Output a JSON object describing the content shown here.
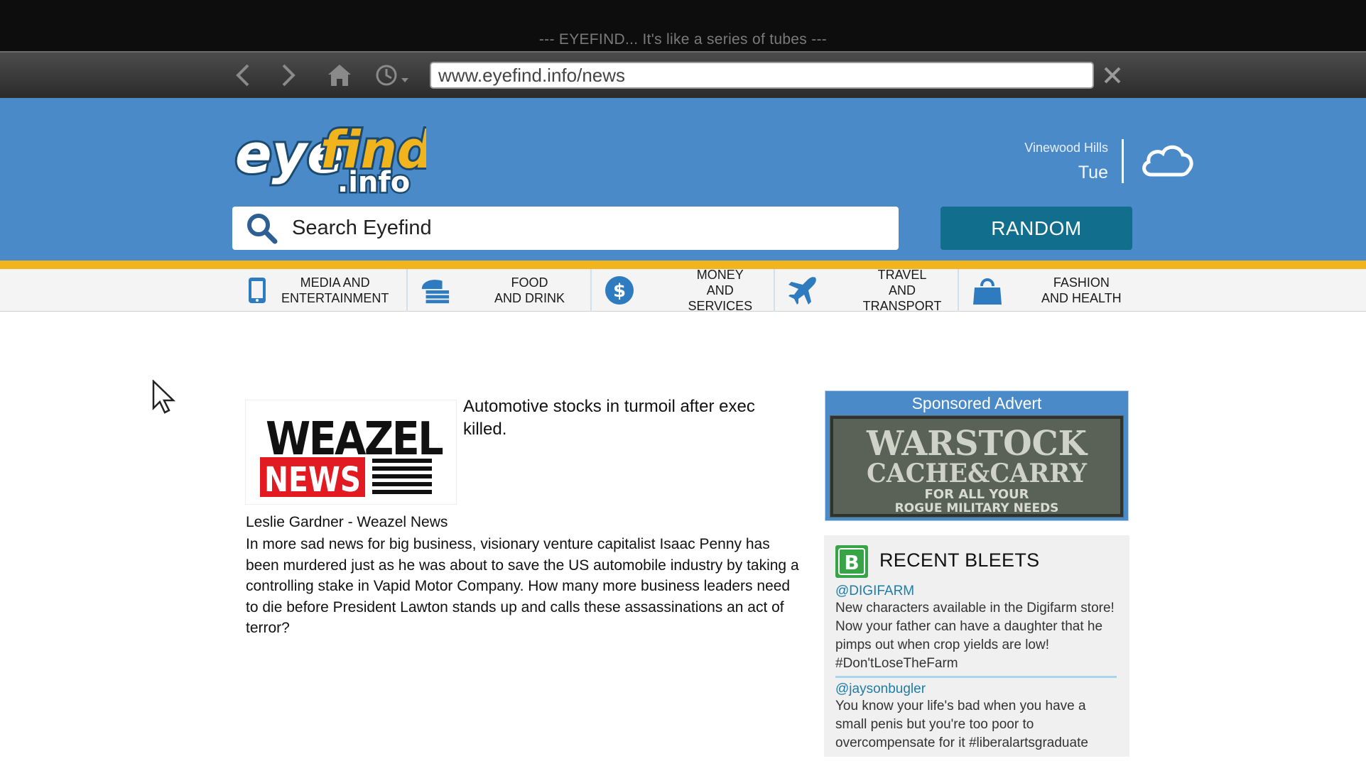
{
  "window": {
    "title": "--- EYEFIND... It's like a series of tubes ---"
  },
  "toolbar": {
    "back_icon": "chevron-left-icon",
    "forward_icon": "chevron-right-icon",
    "home_icon": "home-icon",
    "history_icon": "clock-dropdown-icon",
    "url": "www.eyefind.info/news",
    "close_icon": "close-icon"
  },
  "header": {
    "logo_text": "eyefind.info",
    "location": "Vinewood Hills",
    "day": "Tue",
    "weather_icon": "cloud-icon",
    "search_placeholder": "Search Eyefind",
    "random_label": "RANDOM",
    "colors": {
      "header_blue": "#4a8ac8",
      "accent_yellow": "#f2b41d",
      "button_teal": "#116e8c"
    }
  },
  "categories": [
    {
      "line1": "MEDIA AND",
      "line2": "ENTERTAINMENT",
      "icon": "phone-icon"
    },
    {
      "line1": "FOOD",
      "line2": "AND DRINK",
      "icon": "burger-icon"
    },
    {
      "line1": "MONEY",
      "line2": "AND SERVICES",
      "icon": "dollar-icon"
    },
    {
      "line1": "TRAVEL",
      "line2": "AND TRANSPORT",
      "icon": "plane-icon"
    },
    {
      "line1": "FASHION",
      "line2": "AND HEALTH",
      "icon": "shopping-bag-icon"
    }
  ],
  "article": {
    "source_logo_line1": "WEAZEL",
    "source_logo_line2": "NEWS",
    "headline": "Automotive stocks in turmoil after exec killed.",
    "byline": "Leslie Gardner - Weazel News",
    "body": "In more sad news for big business, visionary venture capitalist Isaac Penny has been murdered just as he was about to save the US automobile industry by taking a controlling stake in Vapid Motor Company. How many more business leaders need to die before President Lawton stands up and calls these assassinations an act of terror?"
  },
  "sidebar": {
    "ad": {
      "label": "Sponsored Advert",
      "line1": "WARSTOCK",
      "line2": "CACHE&CARRY",
      "line3": "FOR ALL YOUR",
      "line4": "ROGUE MILITARY NEEDS"
    },
    "bleets": {
      "title": "RECENT BLEETS",
      "items": [
        {
          "handle": "@DIGIFARM",
          "text": "New characters available in the Digifarm store! Now your father can have a daughter that he pimps out when crop yields are low! #Don'tLoseTheFarm"
        },
        {
          "handle": "@jaysonbugler",
          "text": "You know your life's bad when you have a small penis but you're too poor to overcompensate for it #liberalartsgraduate"
        }
      ]
    }
  }
}
